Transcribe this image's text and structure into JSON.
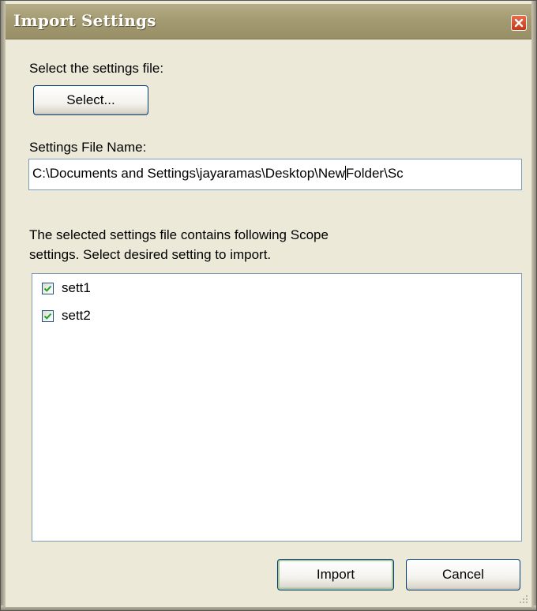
{
  "window": {
    "title": "Import Settings"
  },
  "select_section": {
    "prompt_label": "Select the settings file:",
    "select_button_label": "Select..."
  },
  "file_section": {
    "label": "Settings File Name:",
    "path_before_caret": "C:\\Documents and Settings\\jayaramas\\Desktop\\New",
    "path_after_caret": "Folder\\Sc"
  },
  "description": {
    "line1": "The selected settings file contains following Scope",
    "line2": "settings. Select desired setting to import."
  },
  "settings_list": {
    "items": [
      {
        "label": "sett1",
        "checked": true
      },
      {
        "label": "sett2",
        "checked": true
      }
    ]
  },
  "footer": {
    "import_label": "Import",
    "cancel_label": "Cancel"
  },
  "icons": {
    "close": "close-icon",
    "check": "checkmark-icon",
    "grip": "resize-grip-icon"
  },
  "colors": {
    "title_bar": "#a49b72",
    "close_button": "#c4361a",
    "dialog_background": "#ece9d8",
    "check_color": "#21a121"
  }
}
